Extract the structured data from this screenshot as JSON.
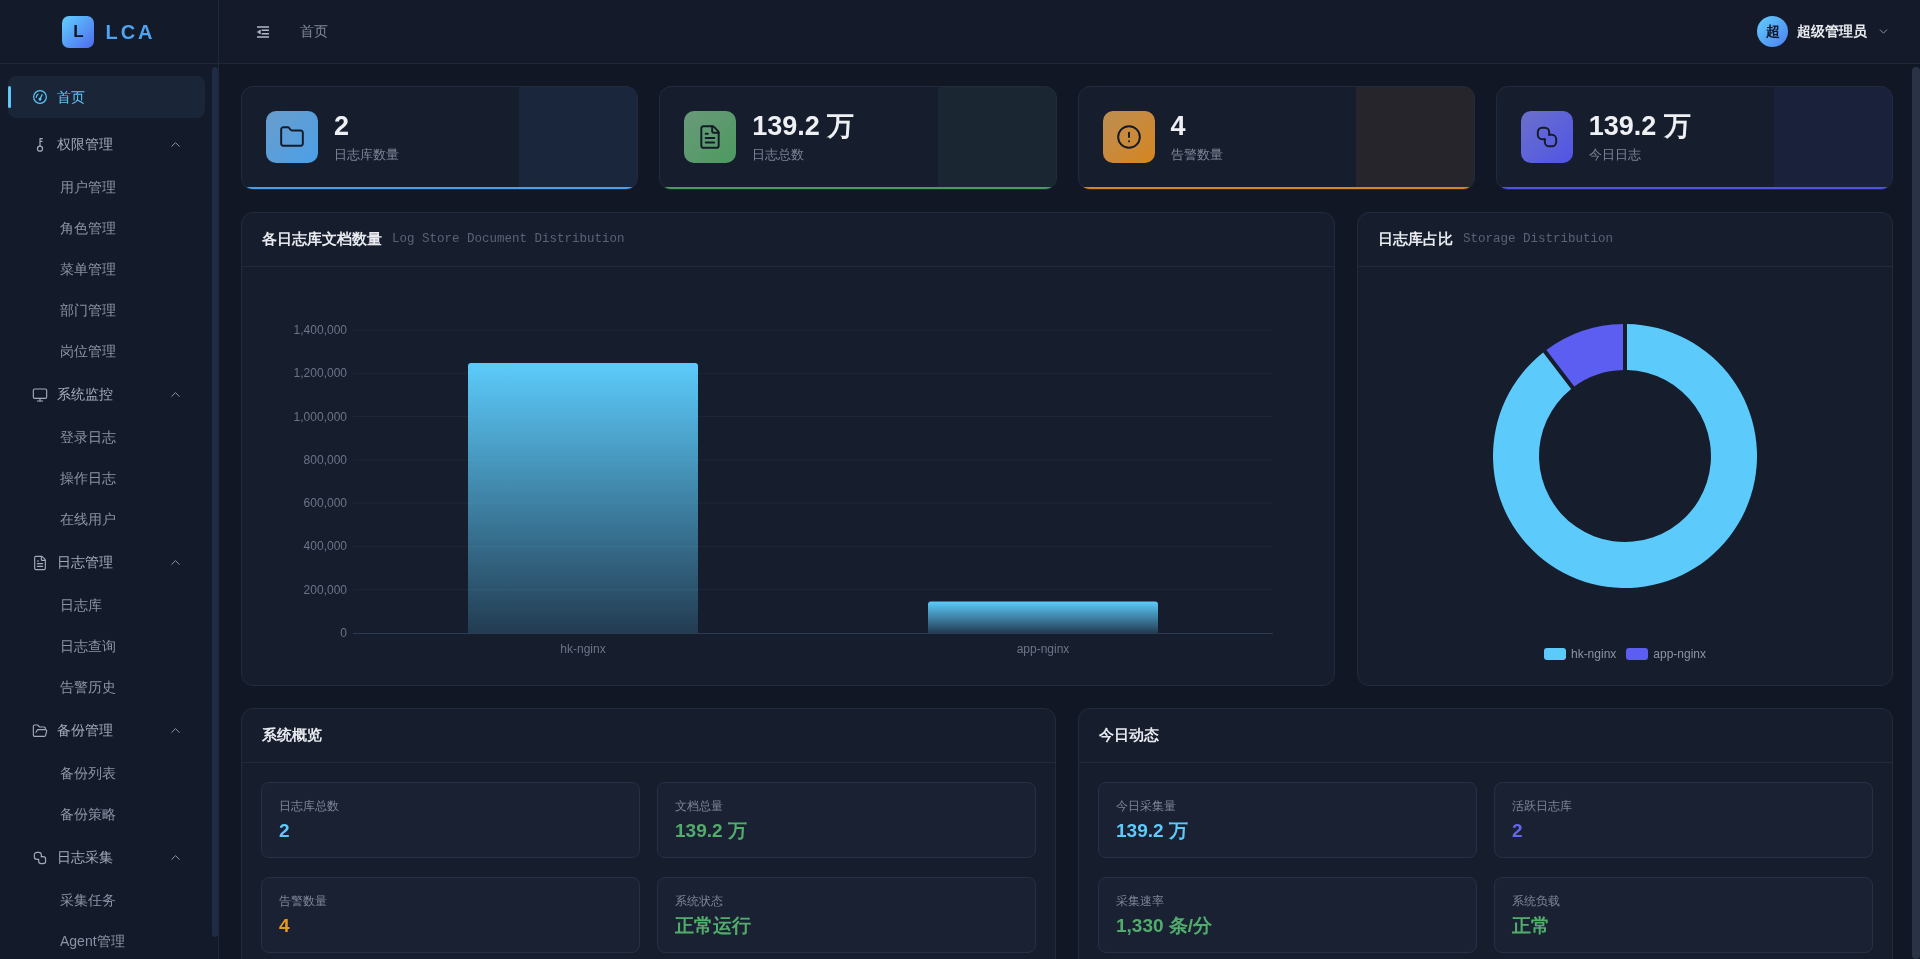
{
  "sidebar": {
    "logo": {
      "mark": "L",
      "text": "LCA"
    },
    "items": [
      {
        "label": "首页",
        "selected": true
      },
      {
        "label": "权限管理",
        "selected": false,
        "expanded": true,
        "children": [
          {
            "label": "用户管理",
            "selected": false
          },
          {
            "label": "角色管理",
            "selected": false
          },
          {
            "label": "菜单管理",
            "selected": false
          },
          {
            "label": "部门管理",
            "selected": false
          },
          {
            "label": "岗位管理",
            "selected": false
          }
        ]
      },
      {
        "label": "系统监控",
        "selected": false,
        "expanded": true,
        "children": [
          {
            "label": "登录日志",
            "selected": false
          },
          {
            "label": "操作日志",
            "selected": false
          },
          {
            "label": "在线用户",
            "selected": false
          }
        ]
      },
      {
        "label": "日志管理",
        "selected": false,
        "expanded": true,
        "children": [
          {
            "label": "日志库",
            "selected": false
          },
          {
            "label": "日志查询",
            "selected": false
          },
          {
            "label": "告警历史",
            "selected": false
          }
        ]
      },
      {
        "label": "备份管理",
        "selected": false,
        "expanded": true,
        "children": [
          {
            "label": "备份列表",
            "selected": false
          },
          {
            "label": "备份策略",
            "selected": false
          }
        ]
      },
      {
        "label": "日志采集",
        "selected": false,
        "expanded": true,
        "children": [
          {
            "label": "采集任务",
            "selected": false
          },
          {
            "label": "Agent管理",
            "selected": false
          }
        ]
      }
    ]
  },
  "header": {
    "breadcrumb": "首页",
    "user": {
      "avatar": "超",
      "name": "超级管理员"
    }
  },
  "stats": [
    {
      "value": "2",
      "label": "日志库数量",
      "color": "#4a9fe8"
    },
    {
      "value": "139.2 万",
      "label": "日志总数",
      "color": "#4c9a60"
    },
    {
      "value": "4",
      "label": "告警数量",
      "color": "#d6861c"
    },
    {
      "value": "139.2 万",
      "label": "今日日志",
      "color": "#5053e6"
    }
  ],
  "doc_chart": {
    "title": "各日志库文档数量",
    "subtitle": "Log Store Document Distribution",
    "chart_data": {
      "type": "bar",
      "categories": [
        "hk-nginx",
        "app-nginx"
      ],
      "series": [
        {
          "color": "#5ccbfb",
          "values": [
            1247000,
            145000
          ]
        }
      ],
      "ylim": [
        0,
        1400000
      ],
      "yticks": [
        {
          "value": 0,
          "label": "0"
        },
        {
          "value": 200000,
          "label": "200,000"
        },
        {
          "value": 400000,
          "label": "400,000"
        },
        {
          "value": 600000,
          "label": "600,000"
        },
        {
          "value": 800000,
          "label": "800,000"
        },
        {
          "value": 1000000,
          "label": "1,000,000"
        },
        {
          "value": 1200000,
          "label": "1,200,000"
        },
        {
          "value": 1400000,
          "label": "1,400,000"
        }
      ],
      "grid": true
    }
  },
  "storage_chart": {
    "title": "日志库占比",
    "subtitle": "Storage Distribution",
    "chart_data": {
      "type": "donut",
      "categories": [
        "hk-nginx",
        "app-nginx"
      ],
      "colors": [
        "#5ccbfb",
        "#5b5ef0"
      ],
      "series": [
        {
          "values": [
            89.6,
            10.4
          ]
        }
      ],
      "legend": "bottom"
    }
  },
  "overview": {
    "title": "系统概览",
    "items": [
      {
        "label": "日志库总数",
        "value": "2",
        "color": "#5ccbfb"
      },
      {
        "label": "文档总量",
        "value": "139.2 万",
        "color": "#52ad6c"
      },
      {
        "label": "告警数量",
        "value": "4",
        "color": "#e29b22"
      },
      {
        "label": "系统状态",
        "value": "正常运行",
        "color": "#52ad6c"
      }
    ]
  },
  "today": {
    "title": "今日动态",
    "items": [
      {
        "label": "今日采集量",
        "value": "139.2 万",
        "color": "#5ccbfb"
      },
      {
        "label": "活跃日志库",
        "value": "2",
        "color": "#6366f1"
      },
      {
        "label": "采集速率",
        "value": "1,330 条/分",
        "color": "#52ad6c"
      },
      {
        "label": "系统负载",
        "value": "正常",
        "color": "#52ad6c"
      }
    ]
  }
}
